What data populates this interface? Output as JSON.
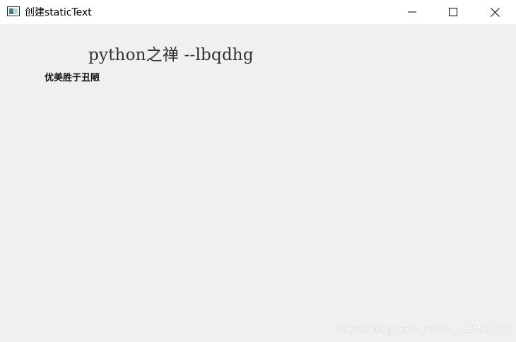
{
  "window": {
    "title": "创建staticText",
    "icon": "app-window-icon",
    "controls": {
      "minimize_icon": "minimize-icon",
      "maximize_icon": "maximize-icon",
      "close_icon": "close-icon"
    }
  },
  "content": {
    "heading": "python之禅 --lbqdhg",
    "subtext": "优美胜于丑陋"
  },
  "watermark": "https://blog.csdn.net/qq_42593798",
  "colors": {
    "titlebar_bg": "#ffffff",
    "client_bg": "#f0f0f0",
    "heading_text": "#333333"
  }
}
